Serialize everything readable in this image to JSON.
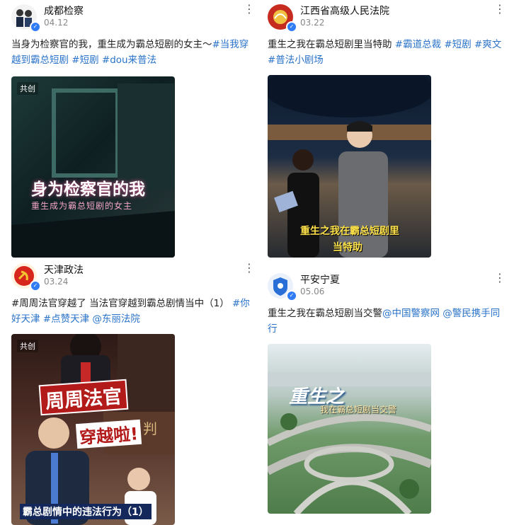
{
  "posts": [
    {
      "author": "成都检察",
      "date": "04.12",
      "caption_text": "当身为检察官的我，重生成为霸总短剧的女主～",
      "tags": "#当我穿越到霸总短剧 #短剧 #dou来普法",
      "badge": "共创",
      "overlay_title": "身为检察官的我",
      "overlay_sub": "重生成为霸总短剧的女主"
    },
    {
      "author": "江西省高级人民法院",
      "date": "03.22",
      "caption_text": "重生之我在霸总短剧里当特助",
      "tags": "#霸道总裁 #短剧 #爽文 #普法小剧场",
      "overlay_title": "重生之我在霸总短剧里",
      "overlay_sub": "当特助"
    },
    {
      "author": "天津政法",
      "date": "03.24",
      "caption_text": "#周周法官穿越了 当法官穿越到霸总剧情当中（1）",
      "tags": "#你好天津 #点赞天津 @东丽法院",
      "badge": "共创",
      "overlay_title": "周周法官",
      "overlay_sub": "穿越啦!",
      "overlay_bottom": "霸总剧情中的违法行为（1）",
      "court_sign": "审判"
    },
    {
      "author": "平安宁夏",
      "date": "05.06",
      "caption_text": "重生之我在霸总短剧当交警",
      "tags": "@中国警察网 @警民携手同行",
      "overlay_title": "重生之",
      "overlay_sub": "我在霸总短剧当交警"
    }
  ],
  "colors": {
    "link": "#2a73c9",
    "verified": "#2f7cf6"
  }
}
